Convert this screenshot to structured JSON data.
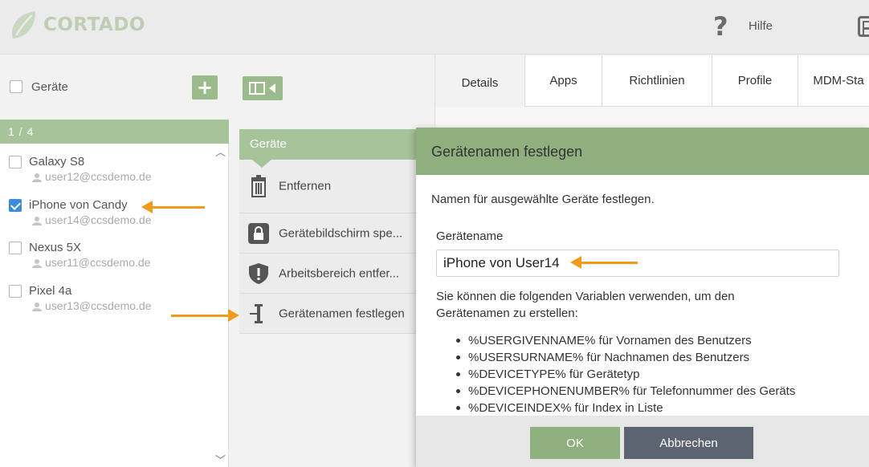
{
  "header": {
    "logo_text": "CORTADO",
    "help_label": "Hilfe",
    "help_icon": "question-mark-icon",
    "apps_icon": "apps-grid-icon"
  },
  "device_panel": {
    "title": "Geräte",
    "count": "1 / 4",
    "devices": [
      {
        "name": "Galaxy S8",
        "email": "user12@ccsdemo.de",
        "checked": false
      },
      {
        "name": "iPhone von Candy",
        "email": "user14@ccsdemo.de",
        "checked": true
      },
      {
        "name": "Nexus 5X",
        "email": "user11@ccsdemo.de",
        "checked": false
      },
      {
        "name": "Pixel 4a",
        "email": "user13@ccsdemo.de",
        "checked": false
      }
    ]
  },
  "action_menu": {
    "title": "Geräte",
    "items": [
      {
        "label": "Entfernen",
        "icon": "trash-icon"
      },
      {
        "label": "Gerätebildschirm spe...",
        "icon": "lock-icon"
      },
      {
        "label": "Arbeitsbereich entfer...",
        "icon": "shield-icon"
      },
      {
        "label": "Gerätenamen festlegen",
        "icon": "text-cursor-icon"
      }
    ]
  },
  "tabs": [
    {
      "label": "Details",
      "active": true
    },
    {
      "label": "Apps",
      "active": false
    },
    {
      "label": "Richtlinien",
      "active": false
    },
    {
      "label": "Profile",
      "active": false
    },
    {
      "label": "MDM-Sta",
      "active": false
    }
  ],
  "dialog": {
    "title": "Gerätenamen festlegen",
    "intro": "Namen für ausgewählte Geräte festlegen.",
    "field_label": "Gerätename",
    "field_value": "iPhone von User14",
    "help_text": "Sie können die folgenden Variablen verwenden, um den Gerätenamen zu erstellen:",
    "variables": [
      "%USERGIVENNAME% für Vornamen des Benutzers",
      "%USERSURNAME% für Nachnamen des Benutzers",
      "%DEVICETYPE% für Gerätetyp",
      "%DEVICEPHONENUMBER% für Telefonnummer des Geräts",
      "%DEVICEINDEX% für Index in Liste"
    ],
    "ok_label": "OK",
    "cancel_label": "Abbrechen"
  },
  "colors": {
    "accent_green": "#9cbb8c",
    "header_green": "#8fb07e",
    "annotation_orange": "#f29a1a",
    "cancel_gray": "#5b6470"
  }
}
